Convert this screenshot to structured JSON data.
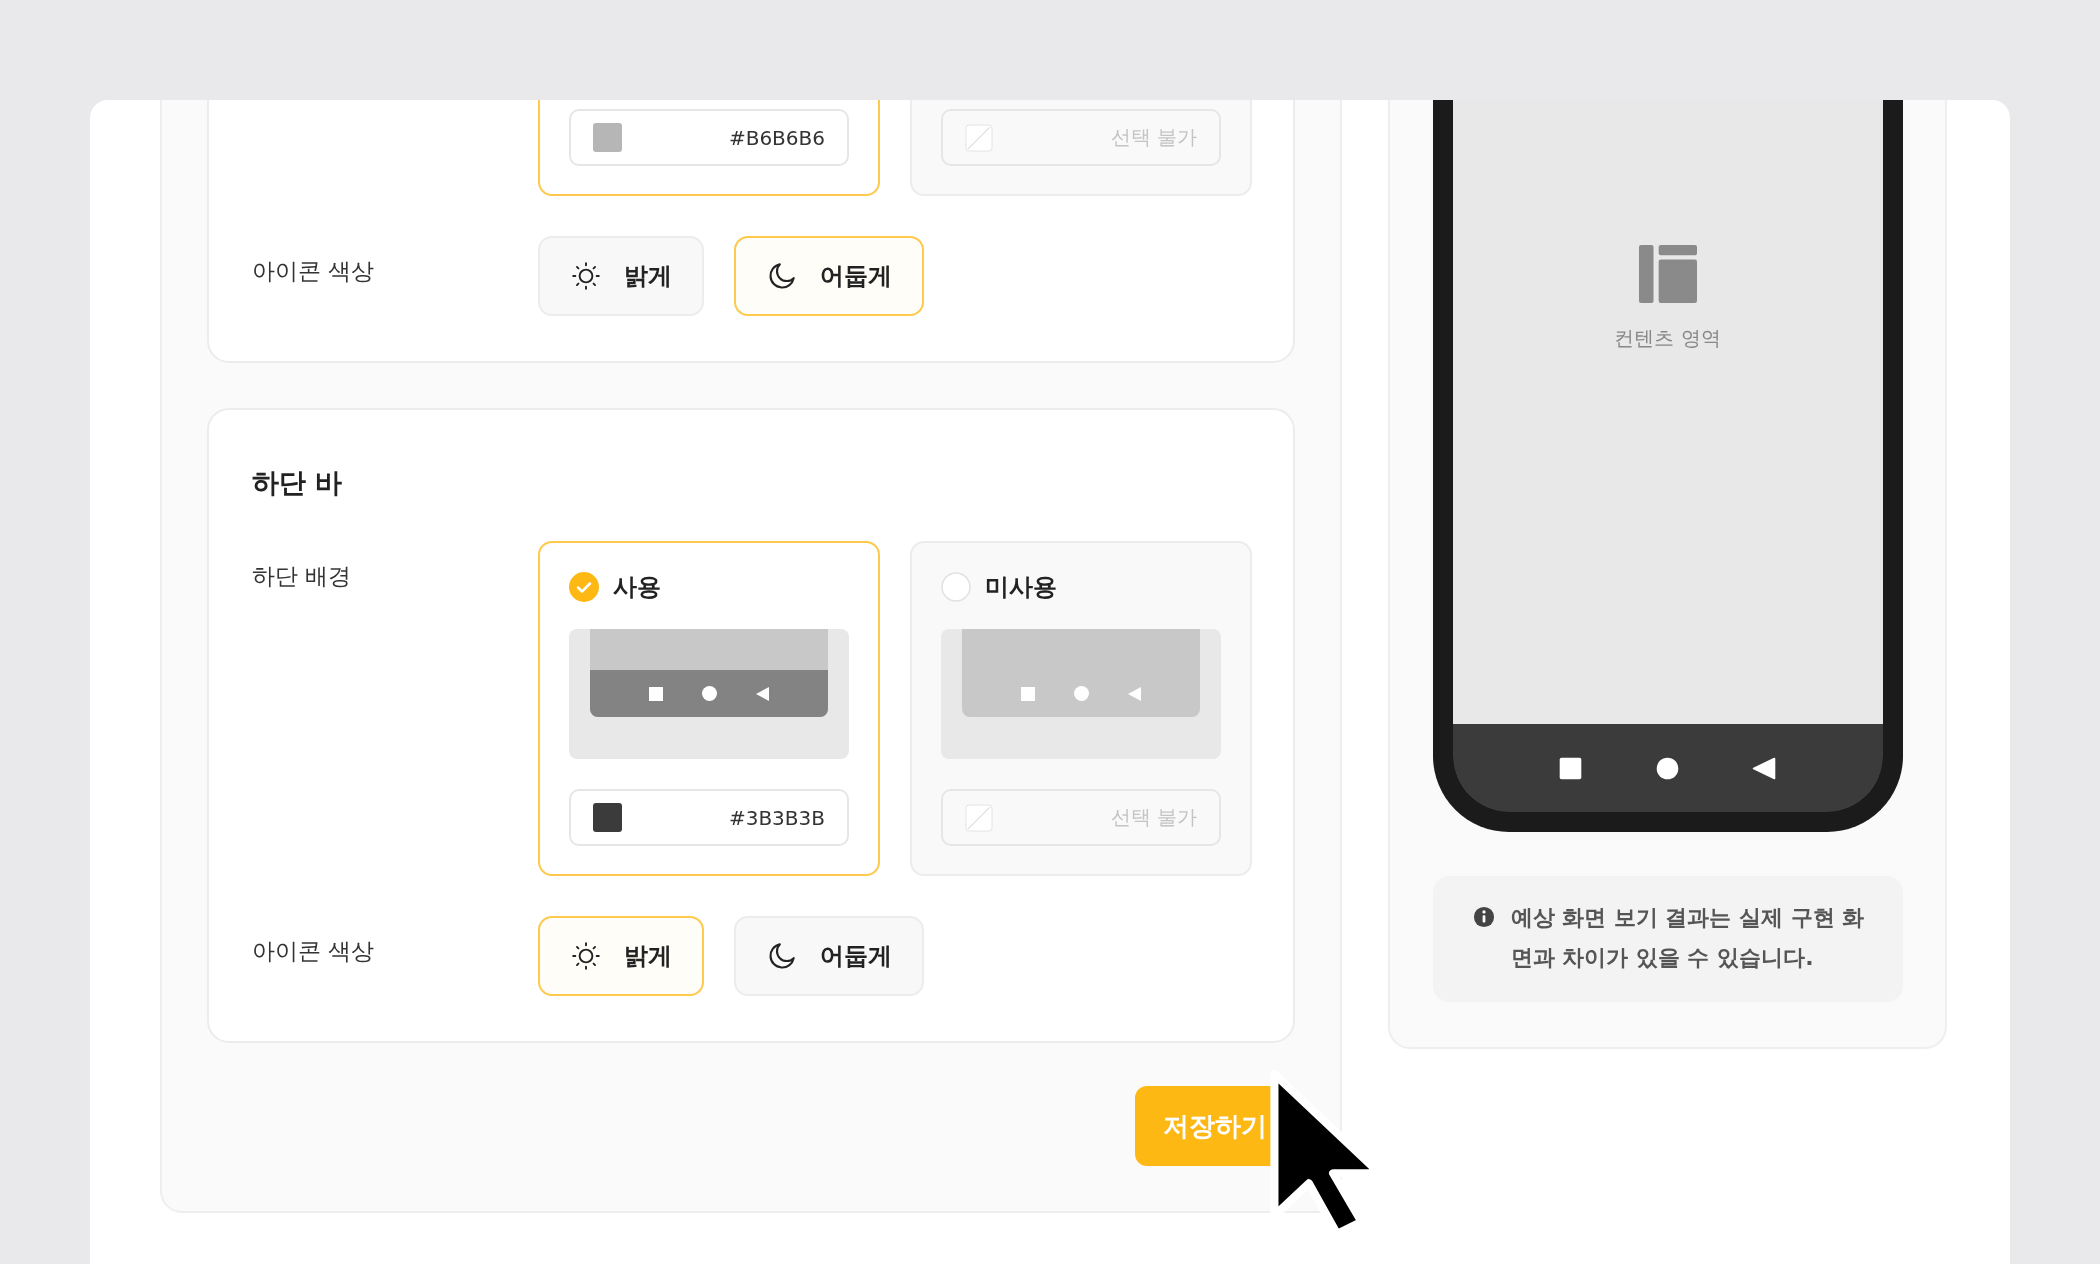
{
  "sections": [
    {
      "rows": [
        {
          "kind": "options",
          "options": [
            {
              "selected": true,
              "field": {
                "value": "#B6B6B6",
                "color": "#b6b6b6",
                "disabled": false
              }
            },
            {
              "selected": false,
              "field": {
                "value": "선택 불가",
                "disabled": true
              }
            }
          ]
        },
        {
          "kind": "icon_color",
          "label": "아이콘 색상",
          "options": [
            {
              "label": "밝게",
              "kind": "sun",
              "selected": false
            },
            {
              "label": "어둡게",
              "kind": "moon",
              "selected": true
            }
          ]
        }
      ]
    },
    {
      "title": "하단 바",
      "rows": [
        {
          "kind": "options",
          "label": "하단 배경",
          "options": [
            {
              "label": "사용",
              "selected": true,
              "kind": "bar",
              "field": {
                "value": "#3B3B3B",
                "color": "#3b3b3b",
                "disabled": false
              }
            },
            {
              "label": "미사용",
              "selected": false,
              "kind": "no_bar",
              "field": {
                "value": "선택 불가",
                "disabled": true
              }
            }
          ]
        },
        {
          "kind": "icon_color",
          "label": "아이콘 색상",
          "options": [
            {
              "label": "밝게",
              "kind": "sun",
              "selected": true
            },
            {
              "label": "어둡게",
              "kind": "moon",
              "selected": false
            }
          ]
        }
      ]
    }
  ],
  "save_button": "저장하기",
  "preview": {
    "content_label": "컨텐츠 영역",
    "notice": "예상 화면 보기 결과는 실제 구현 화면과 차이가 있을 수 있습니다."
  }
}
